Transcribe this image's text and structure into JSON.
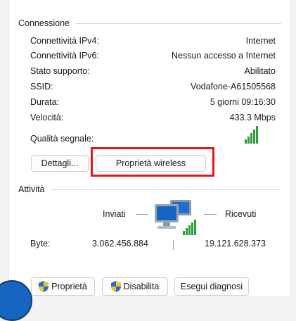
{
  "connection": {
    "header": "Connessione",
    "rows": [
      {
        "label": "Connettività IPv4:",
        "value": "Internet"
      },
      {
        "label": "Connettività IPv6:",
        "value": "Nessun accesso a Internet"
      },
      {
        "label": "Stato supporto:",
        "value": "Abilitato"
      },
      {
        "label": "SSID:",
        "value": "Vodafone-A61505568"
      },
      {
        "label": "Durata:",
        "value": "5 giorni 09:16:30"
      },
      {
        "label": "Velocità:",
        "value": "433.3 Mbps"
      }
    ],
    "signal_label": "Qualità segnale:",
    "signal_bars_lit": 5,
    "signal_bars_total": 5
  },
  "buttons": {
    "details": "Dettagli...",
    "wireless_properties": "Proprietà wireless",
    "properties": "Proprietà",
    "disable": "Disabilita",
    "diagnose": "Esegui diagnosi"
  },
  "activity": {
    "header": "Attività",
    "sent_label": "Inviati",
    "received_label": "Ricevuti",
    "bytes_label": "Byte:",
    "bytes_sent": "3.062.456.884",
    "bytes_received": "19.121.628.373"
  },
  "colors": {
    "highlight": "#e01b1b",
    "signal": "#2e9e3d",
    "computer_screen": "#1565c0"
  },
  "icons": [
    "signal-strength-icon",
    "network-computers-icon",
    "shield-icon"
  ]
}
